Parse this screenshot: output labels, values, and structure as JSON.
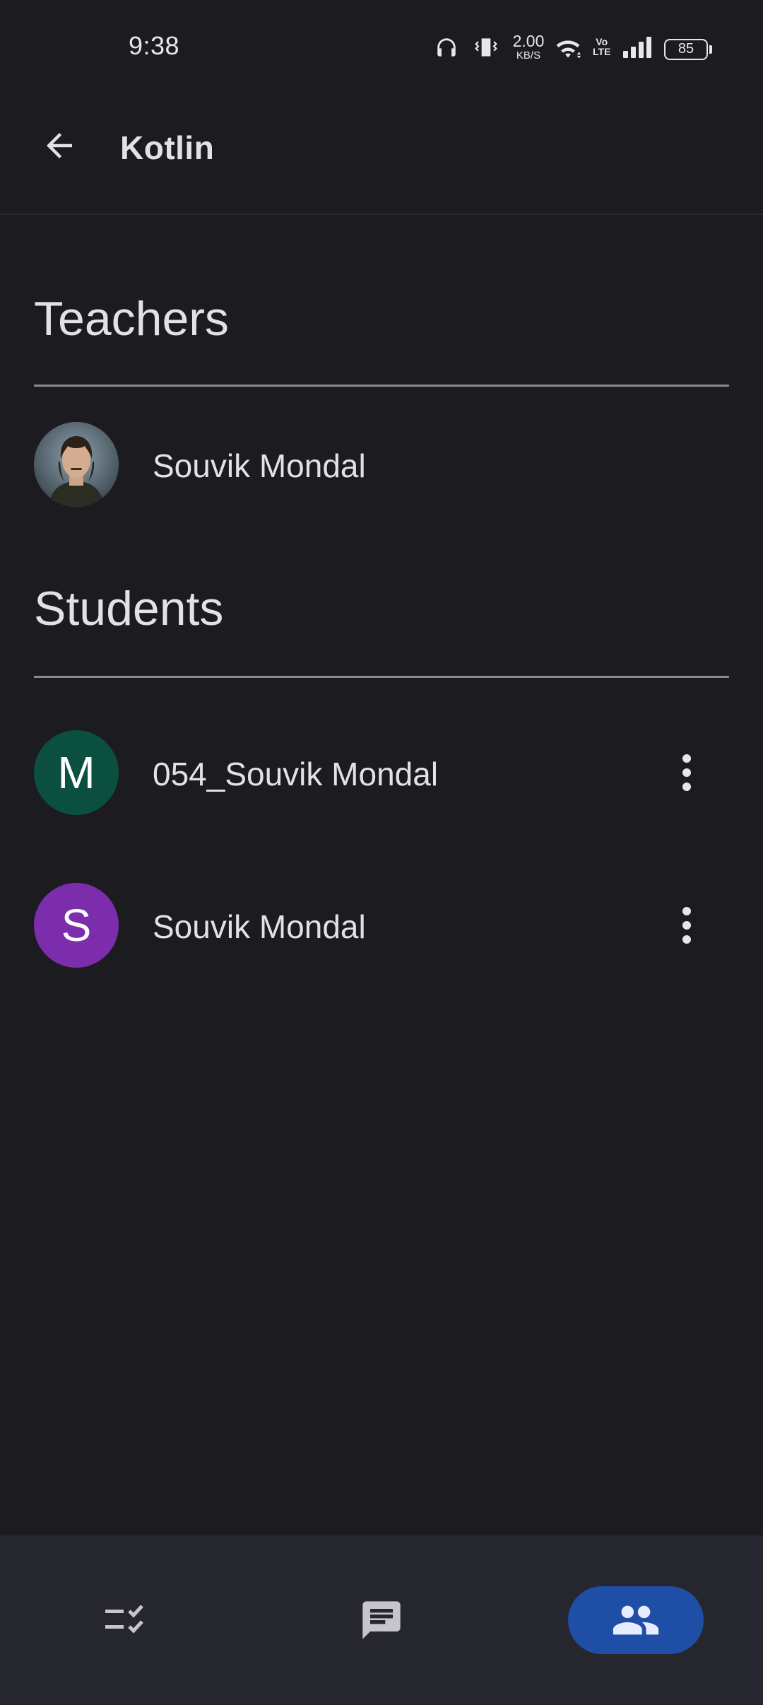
{
  "status_bar": {
    "time": "9:38",
    "net_speed_value": "2.00",
    "net_speed_unit": "KB/S",
    "volte_top": "Vo",
    "volte_bottom": "LTE",
    "battery": "85",
    "icons": [
      "headphones-icon",
      "vibrate-icon",
      "wifi-icon",
      "volte-icon",
      "signal-icon",
      "battery-icon"
    ]
  },
  "app_bar": {
    "title": "Kotlin",
    "back_icon": "arrow-back-icon"
  },
  "teachers": {
    "heading": "Teachers",
    "people": [
      {
        "name": "Souvik Mondal",
        "avatar": "photo"
      }
    ]
  },
  "students": {
    "heading": "Students",
    "people": [
      {
        "name": "054_Souvik Mondal",
        "initial": "M",
        "color": "#0b4f40"
      },
      {
        "name": "Souvik Mondal",
        "initial": "S",
        "color": "#7b2dab"
      }
    ]
  },
  "bottom_nav": {
    "items": [
      {
        "icon": "classwork-icon",
        "active": false
      },
      {
        "icon": "stream-icon",
        "active": false
      },
      {
        "icon": "people-icon",
        "active": true
      }
    ],
    "active_color": "#1f4ea6"
  }
}
